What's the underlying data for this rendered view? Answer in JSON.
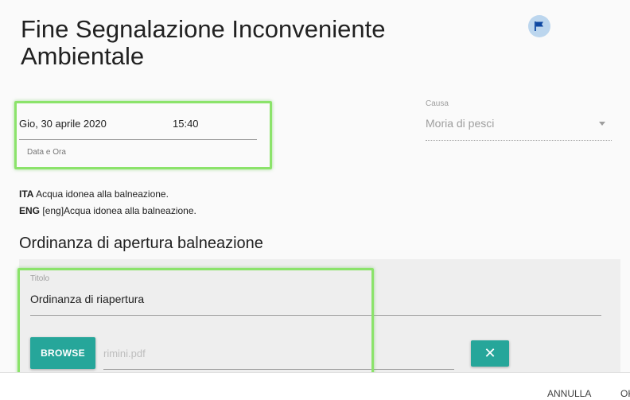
{
  "dialog": {
    "title_line1": "Fine Segnalazione Inconveniente",
    "title_line2": "Ambientale",
    "flag_icon": "flag-icon",
    "flag_color": "#0d47a1"
  },
  "datetime": {
    "date": "Gio, 30 aprile 2020",
    "time": "15:40",
    "label": "Data e Ora"
  },
  "causa": {
    "label": "Causa",
    "value": "Moria di pesci"
  },
  "info": {
    "ita_tag": "ITA",
    "ita_text": "Acqua idonea alla balneazione.",
    "eng_tag": "ENG",
    "eng_text": "[eng]Acqua idonea alla balneazione."
  },
  "section": {
    "title": "Ordinanza di apertura balneazione"
  },
  "attachment": {
    "titolo_label": "Titolo",
    "titolo_value": "Ordinanza di riapertura",
    "browse_label": "BROWSE",
    "file_name": "rimini.pdf",
    "clear_icon": "close-icon"
  },
  "footer": {
    "cancel_label": "ANNULLA",
    "ok_label": "OK"
  },
  "colors": {
    "accent": "#26a69a",
    "highlight": "#8be36a"
  }
}
